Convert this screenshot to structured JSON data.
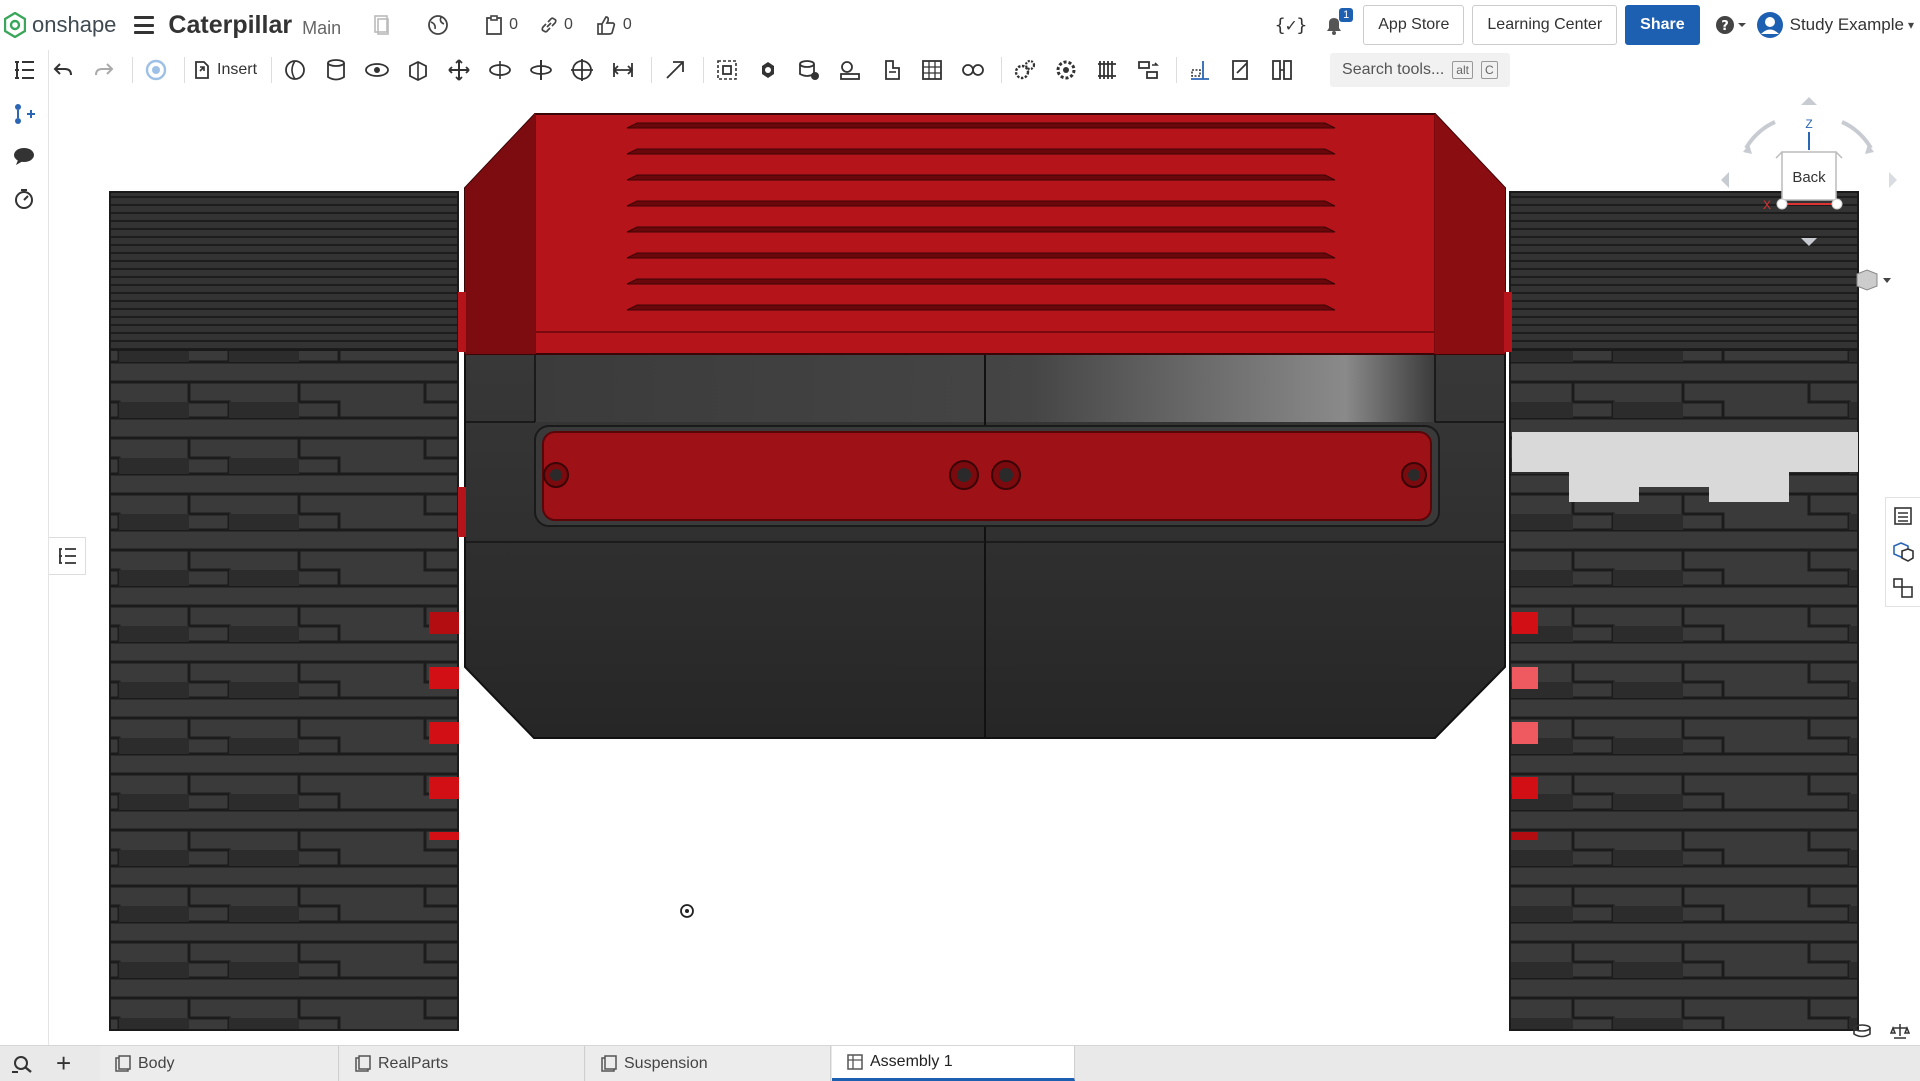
{
  "app": {
    "brand": "onshape",
    "document_title": "Caterpillar",
    "branch": "Main"
  },
  "counters": {
    "parts": "0",
    "links": "0",
    "likes": "0"
  },
  "header_buttons": {
    "app_store": "App Store",
    "learning_center": "Learning Center",
    "share": "Share",
    "user": "Study Example",
    "notifications": "1"
  },
  "toolbar": {
    "insert_label": "Insert",
    "search_placeholder": "Search tools...",
    "search_shortcut_mod": "alt",
    "search_shortcut_key": "C"
  },
  "view_cube": {
    "face_label": "Back",
    "axis_z": "Z",
    "axis_x": "X"
  },
  "tabs": [
    {
      "label": "Body",
      "type": "part-studio"
    },
    {
      "label": "RealParts",
      "type": "part-studio"
    },
    {
      "label": "Suspension",
      "type": "part-studio"
    },
    {
      "label": "Assembly 1",
      "type": "assembly",
      "active": true
    }
  ],
  "colors": {
    "accent": "#1d5fb0",
    "body_red": "#b5141a",
    "track_dark": "#2a2a2a"
  },
  "icons": [
    "undo-icon",
    "redo-icon",
    "insert-icon",
    "fillet-icon",
    "extrude-icon",
    "chamfer-icon",
    "shell-icon",
    "move-icon",
    "mate-icon",
    "search-icon",
    "comment-icon",
    "timer-icon"
  ]
}
